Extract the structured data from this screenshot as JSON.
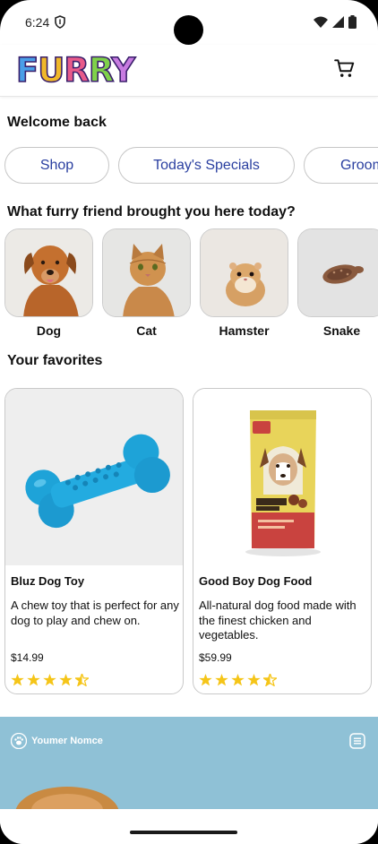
{
  "status_bar": {
    "time": "6:24"
  },
  "app": {
    "logo_text": "FURRY",
    "logo_colors": [
      "#4a9fe8",
      "#f0b82a",
      "#e85a8a",
      "#7fd14a",
      "#c77be0"
    ]
  },
  "header": {
    "cart_icon": "cart-icon"
  },
  "welcome": "Welcome back",
  "chips": [
    {
      "label": "Shop"
    },
    {
      "label": "Today's Specials"
    },
    {
      "label": "Groom"
    }
  ],
  "question": "What furry friend brought you here today?",
  "pets": [
    {
      "name": "Dog"
    },
    {
      "name": "Cat"
    },
    {
      "name": "Hamster"
    },
    {
      "name": "Snake"
    }
  ],
  "favorites_title": "Your favorites",
  "favorites": [
    {
      "title": "Bluz Dog Toy",
      "description": "A chew toy that is perfect for any dog to play and chew on.",
      "price": "$14.99",
      "rating": 4.5
    },
    {
      "title": "Good Boy Dog Food",
      "description": "All-natural dog food made with the finest chicken and vegetables.",
      "price": "$59.99",
      "rating": 4.5
    }
  ],
  "banner": {
    "brand": "Youmer Nomce"
  },
  "colors": {
    "accent": "#2a3fa0",
    "star": "#f5c518",
    "banner": "#8fc1d6"
  }
}
